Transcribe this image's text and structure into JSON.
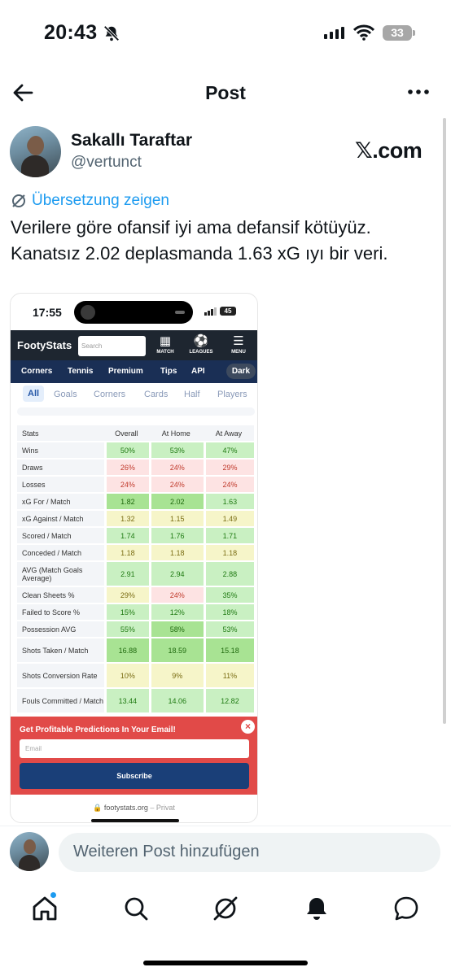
{
  "status": {
    "time": "20:43",
    "battery": "33"
  },
  "header": {
    "title": "Post"
  },
  "author": {
    "name": "Sakallı Taraftar",
    "handle": "@vertunct",
    "source_badge": "𝕏.com"
  },
  "translate_label": "Übersetzung zeigen",
  "post_text": "Verilere göre ofansif iyi ama defansif kötüyüz. Kanatsız 2.02 deplasmanda 1.63 xG ıyı bir veri.",
  "screenshot": {
    "time": "17:55",
    "battery": "45",
    "logo": "FootyStats",
    "search_placeholder": "Search",
    "icons": {
      "match": "MATCH",
      "leagues": "LEAGUES",
      "menu": "MENU"
    },
    "nav": [
      "Corners",
      "Tennis",
      "Premium",
      "Tips",
      "API"
    ],
    "dark_label": "Dark",
    "tabs": [
      "All",
      "Goals",
      "Corners",
      "Cards",
      "Half",
      "Players"
    ],
    "table": {
      "headers": [
        "Stats",
        "Overall",
        "At Home",
        "At Away"
      ],
      "rows": [
        [
          "Wins",
          "50%",
          "53%",
          "47%"
        ],
        [
          "Draws",
          "26%",
          "24%",
          "29%"
        ],
        [
          "Losses",
          "24%",
          "24%",
          "24%"
        ],
        [
          "xG For / Match",
          "1.82",
          "2.02",
          "1.63"
        ],
        [
          "xG Against / Match",
          "1.32",
          "1.15",
          "1.49"
        ],
        [
          "Scored / Match",
          "1.74",
          "1.76",
          "1.71"
        ],
        [
          "Conceded / Match",
          "1.18",
          "1.18",
          "1.18"
        ],
        [
          "AVG (Match Goals Average)",
          "2.91",
          "2.94",
          "2.88"
        ],
        [
          "Clean Sheets %",
          "29%",
          "24%",
          "35%"
        ],
        [
          "Failed to Score %",
          "15%",
          "12%",
          "18%"
        ],
        [
          "Possession AVG",
          "55%",
          "58%",
          "53%"
        ],
        [
          "Shots Taken / Match",
          "16.88",
          "18.59",
          "15.18"
        ],
        [
          "Shots Conversion Rate",
          "10%",
          "9%",
          "11%"
        ],
        [
          "Fouls Committed / Match",
          "13.44",
          "14.06",
          "12.82"
        ]
      ]
    },
    "promo": {
      "title": "Get Profitable Predictions In Your Email!",
      "email_placeholder": "Email",
      "button": "Subscribe",
      "close": "×"
    },
    "url": "footystats.org",
    "url_suffix": "– Privat"
  },
  "reply": {
    "placeholder": "Weiteren Post hinzufügen"
  },
  "tabbar": [
    "home-icon",
    "search-icon",
    "grok-icon",
    "notifications-icon",
    "messages-icon"
  ],
  "colors": {
    "accent": "#1d9bf0",
    "text": "#0f1419",
    "muted": "#536471",
    "promo": "#e14a48",
    "fs_nav": "#1a2f55"
  }
}
